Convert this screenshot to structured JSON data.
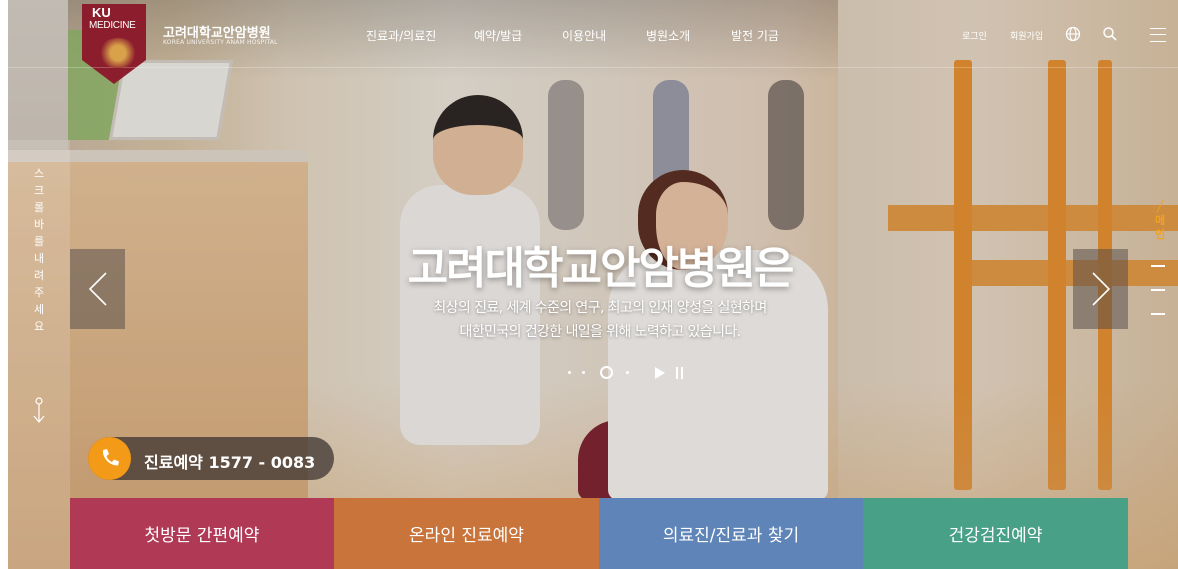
{
  "brand": {
    "logo_line1": "KU",
    "logo_line2": "MEDICINE",
    "name": "고려대학교안암병원",
    "name_en": "KOREA UNIVERSITY ANAM HOSPITAL"
  },
  "nav": {
    "items": [
      {
        "label": "진료과/의료진"
      },
      {
        "label": "예약/발급"
      },
      {
        "label": "이용안내"
      },
      {
        "label": "병원소개"
      },
      {
        "label": "발전 기금"
      }
    ]
  },
  "util": {
    "login": "로그인",
    "signup": "회원가입",
    "icons": [
      "globe-icon",
      "search-icon",
      "menu-icon"
    ]
  },
  "scroll_hint": {
    "text": "스크롤바를 내려주세요"
  },
  "hero": {
    "title": "고려대학교안암병원은",
    "sub1": "최상의 진료, 세계 수준의 연구, 최고의 인재 양성을 실현하며",
    "sub2": "대한민국의 건강한 내일을 위해 노력하고 있습니다."
  },
  "side": {
    "label": "메인"
  },
  "phone": {
    "label": "진료예약 1577 - 0083"
  },
  "quick": [
    {
      "label": "첫방문 간편예약",
      "color": "#b03a55"
    },
    {
      "label": "온라인 진료예약",
      "color": "#c8743a"
    },
    {
      "label": "의료진/진료과 찾기",
      "color": "#5e84b8"
    },
    {
      "label": "건강검진예약",
      "color": "#48a086"
    }
  ],
  "colors": {
    "accent_orange": "#f39b19",
    "brand_crimson": "#8c1d2c"
  }
}
